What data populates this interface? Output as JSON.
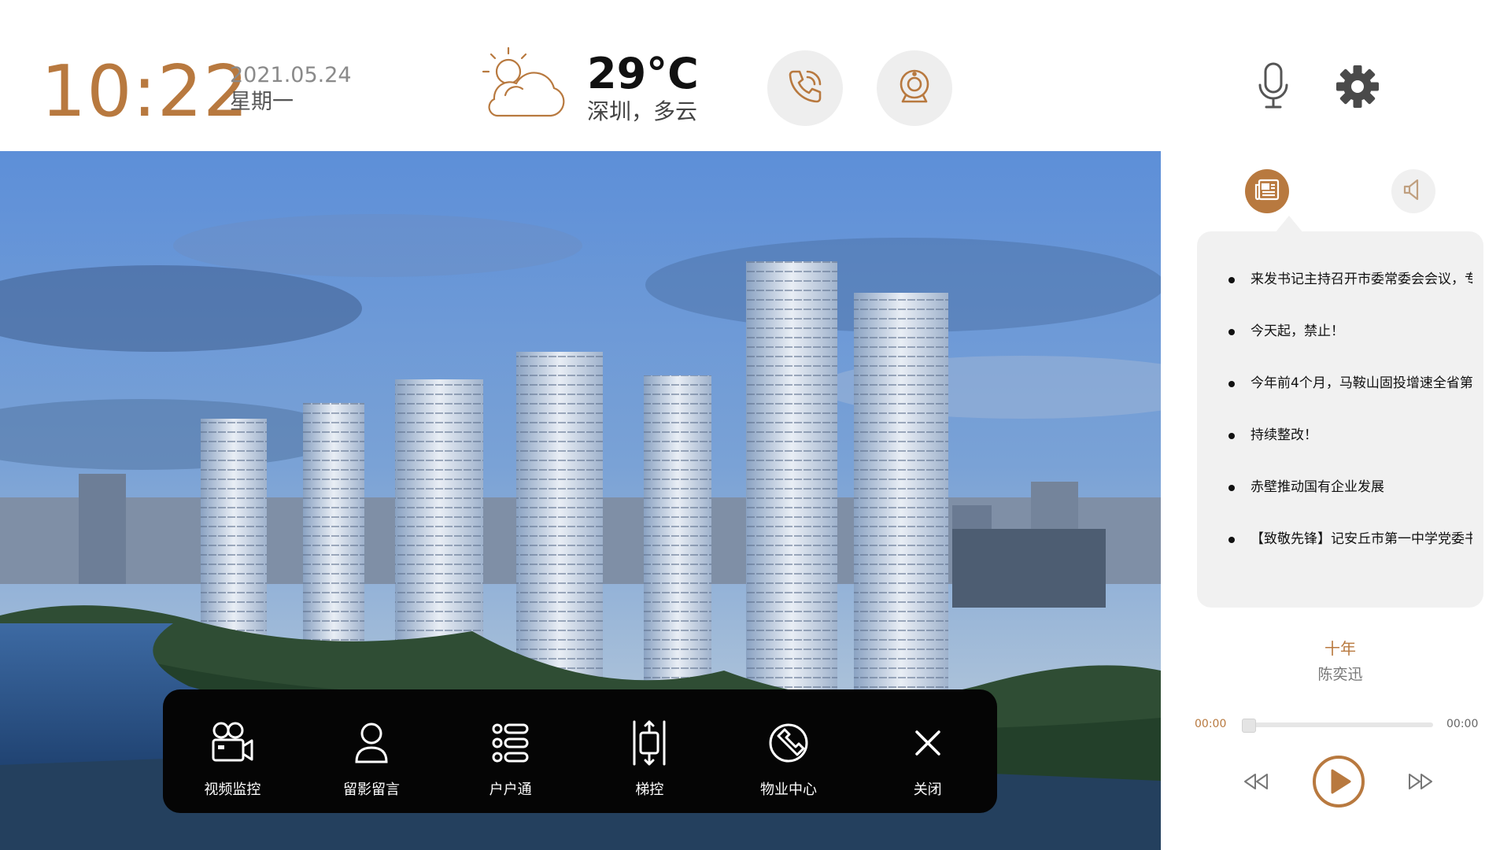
{
  "header": {
    "time": "10:22",
    "date": "2021.05.24",
    "weekday": "星期一",
    "temperature": "29°C",
    "location_weather": "深圳，多云",
    "weather_icon": "partly-cloudy-icon"
  },
  "dock": {
    "items": [
      {
        "label": "视频监控",
        "icon": "video-camera-icon"
      },
      {
        "label": "留影留言",
        "icon": "user-message-icon"
      },
      {
        "label": "户户通",
        "icon": "list-icon"
      },
      {
        "label": "梯控",
        "icon": "elevator-icon"
      },
      {
        "label": "物业中心",
        "icon": "wrench-icon"
      },
      {
        "label": "关闭",
        "icon": "close-icon"
      }
    ]
  },
  "news": {
    "items": [
      "来发书记主持召开市委常委会会议，专",
      "今天起，禁止！",
      "今年前4个月，马鞍山固投增速全省第",
      "持续整改！",
      "赤壁推动国有企业发展",
      "【致敬先锋】记安丘市第一中学党委书"
    ]
  },
  "player": {
    "title": "十年",
    "artist": "陈奕迅",
    "current_time": "00:00",
    "total_time": "00:00",
    "progress": 0
  },
  "colors": {
    "accent": "#b8793f",
    "dock_bg": "#050505",
    "card_bg": "#f1f1f1"
  }
}
